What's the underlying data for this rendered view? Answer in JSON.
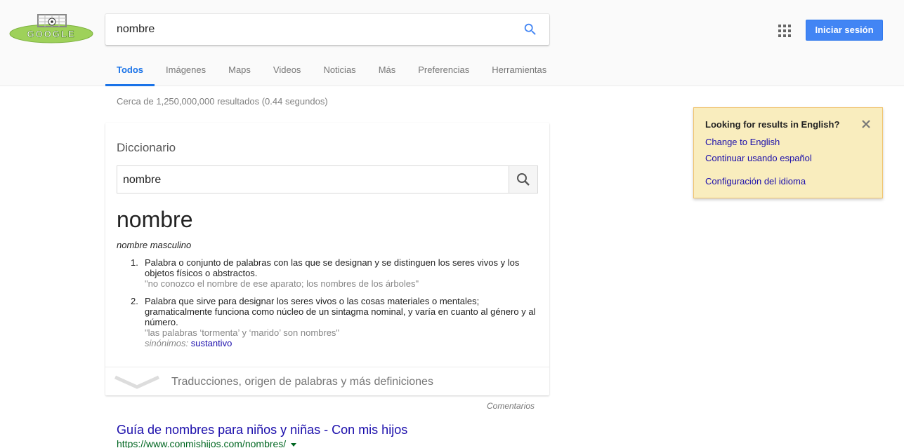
{
  "search": {
    "query": "nombre"
  },
  "header": {
    "signin_label": "Iniciar sesión"
  },
  "tabs": [
    {
      "label": "Todos",
      "active": true
    },
    {
      "label": "Imágenes"
    },
    {
      "label": "Maps"
    },
    {
      "label": "Videos"
    },
    {
      "label": "Noticias"
    },
    {
      "label": "Más"
    },
    {
      "label": "Preferencias"
    },
    {
      "label": "Herramientas"
    }
  ],
  "stats": "Cerca de 1,250,000,000 resultados (0.44 segundos)",
  "dictionary": {
    "title": "Diccionario",
    "search_value": "nombre",
    "word": "nombre",
    "part_of_speech": "nombre masculino",
    "definitions": [
      {
        "num": "1.",
        "text": "Palabra o conjunto de palabras con las que se designan y se distinguen los seres vivos y los objetos físicos o abstractos.",
        "example": "\"no conozco el nombre de ese aparato; los nombres de los árboles\""
      },
      {
        "num": "2.",
        "text": "Palabra que sirve para designar los seres vivos o las cosas materiales o mentales; gramaticalmente funciona como núcleo de un sintagma nominal, y varía en cuanto al género y al número.",
        "example": "\"las palabras ‘tormenta’ y ‘marido’ son nombres\"",
        "synonyms_label": "sinónimos:",
        "synonyms": "sustantivo"
      }
    ],
    "more_label": "Traducciones, origen de palabras y más definiciones"
  },
  "feedback_label": "Comentarios",
  "result": {
    "title": "Guía de nombres para niños y niñas - Con mis hijos",
    "url": "https://www.conmishijos.com/nombres/"
  },
  "language_box": {
    "title": "Looking for results in English?",
    "change_label": "Change to English",
    "continue_label": "Continuar usando español",
    "settings_label": "Configuración del idioma"
  },
  "colors": {
    "accent": "#1a73e8",
    "signin": "#4285f4",
    "link": "#1a0dab",
    "url": "#006621",
    "notice_bg": "#f9edbe"
  }
}
